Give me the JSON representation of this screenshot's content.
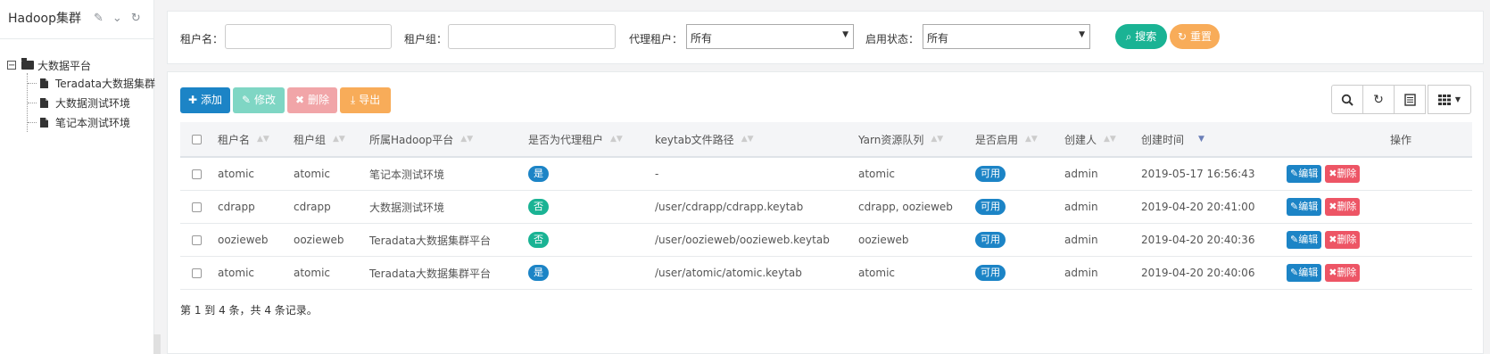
{
  "sidebar": {
    "title": "Hadoop集群",
    "tree": {
      "root_label": "大数据平台",
      "toggle": "−",
      "children": [
        "Teradata大数据集群",
        "大数据测试环境",
        "笔记本测试环境"
      ]
    }
  },
  "search": {
    "tenant_name_label": "租户名：",
    "tenant_name_value": "",
    "tenant_group_label": "租户组：",
    "tenant_group_value": "",
    "proxy_label": "代理租户：",
    "proxy_value": "所有",
    "status_label": "启用状态：",
    "status_value": "所有",
    "search_button": "搜索",
    "reset_button": "重置"
  },
  "toolbar": {
    "add": "添加",
    "edit": "修改",
    "delete": "删除",
    "export": "导出"
  },
  "table": {
    "columns": [
      "租户名",
      "租户组",
      "所属Hadoop平台",
      "是否为代理租户",
      "keytab文件路径",
      "Yarn资源队列",
      "是否启用",
      "创建人",
      "创建时间",
      "操作"
    ],
    "rows": [
      {
        "name": "atomic",
        "group": "atomic",
        "platform": "笔记本测试环境",
        "proxy": "是",
        "keytab": "-",
        "queue": "atomic",
        "enabled": "可用",
        "creator": "admin",
        "created": "2019-05-17 16:56:43"
      },
      {
        "name": "cdrapp",
        "group": "cdrapp",
        "platform": "大数据测试环境",
        "proxy": "否",
        "keytab": "/user/cdrapp/cdrapp.keytab",
        "queue": "cdrapp, oozieweb",
        "enabled": "可用",
        "creator": "admin",
        "created": "2019-04-20 20:41:00"
      },
      {
        "name": "oozieweb",
        "group": "oozieweb",
        "platform": "Teradata大数据集群平台",
        "proxy": "否",
        "keytab": "/user/oozieweb/oozieweb.keytab",
        "queue": "oozieweb",
        "enabled": "可用",
        "creator": "admin",
        "created": "2019-04-20 20:40:36"
      },
      {
        "name": "atomic",
        "group": "atomic",
        "platform": "Teradata大数据集群平台",
        "proxy": "是",
        "keytab": "/user/atomic/atomic.keytab",
        "queue": "atomic",
        "enabled": "可用",
        "creator": "admin",
        "created": "2019-04-20 20:40:06"
      }
    ],
    "row_edit": "编辑",
    "row_delete": "删除",
    "footer": "第 1 到 4 条，共 4 条记录。"
  },
  "colors": {
    "primary": "#1c84c6",
    "success": "#1ab394",
    "warning": "#f8ac59",
    "danger": "#ed5565"
  }
}
